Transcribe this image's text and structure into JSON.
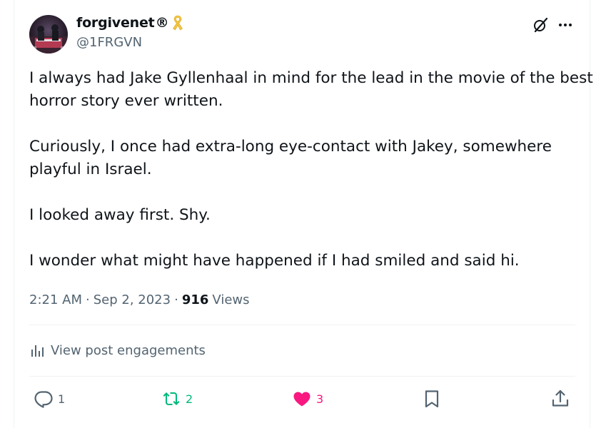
{
  "author": {
    "display_name": "forgivenet",
    "name_suffix": "®",
    "handle": "@1FRGVN",
    "ribbon_icon": "yellow-ribbon-icon"
  },
  "post": {
    "paragraphs": [
      [
        "I always had Jake Gyllenhaal in mind for the lead in the movie of the best",
        "horror story ever written."
      ],
      [
        "Curiously, I once had extra-long eye-contact with Jakey, somewhere",
        "playful in Israel."
      ],
      [
        "I looked away first. Shy."
      ],
      [
        "I wonder what might have happened if I had smiled and said hi."
      ]
    ],
    "time": "2:21 AM",
    "separator": "·",
    "date": "Sep 2, 2023",
    "views_count": "916",
    "views_label": "Views"
  },
  "engagements": {
    "label": "View post engagements",
    "icon": "bar-chart-icon"
  },
  "actions": {
    "reply_count": "1",
    "repost_count": "2",
    "like_count": "3"
  },
  "colors": {
    "text_primary": "#0f1419",
    "text_secondary": "#536471",
    "repost_green": "#00ba7c",
    "like_pink": "#f91880",
    "ribbon_yellow": "#f4c542",
    "divider": "#eff3f4"
  }
}
